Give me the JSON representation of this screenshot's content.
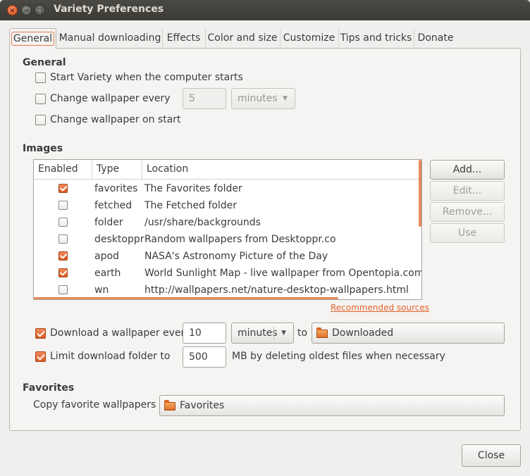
{
  "window": {
    "title": "Variety Preferences",
    "close_glyph": "×",
    "minimize_glyph": "−",
    "maximize_glyph": "□"
  },
  "tabs": [
    {
      "label": "General",
      "active": true
    },
    {
      "label": "Manual downloading"
    },
    {
      "label": "Effects"
    },
    {
      "label": "Color and size"
    },
    {
      "label": "Customize"
    },
    {
      "label": "Tips and tricks"
    },
    {
      "label": "Donate"
    }
  ],
  "general": {
    "heading": "General",
    "start_variety_label": "Start Variety when the computer starts",
    "start_variety_checked": false,
    "change_every_label": "Change wallpaper every",
    "change_every_checked": false,
    "change_every_value": "5",
    "change_every_unit": "minutes",
    "change_on_start_label": "Change wallpaper on start",
    "change_on_start_checked": false
  },
  "images": {
    "heading": "Images",
    "columns": [
      "Enabled",
      "Type",
      "Location"
    ],
    "rows": [
      {
        "enabled": true,
        "type": "favorites",
        "location": "The Favorites folder"
      },
      {
        "enabled": false,
        "type": "fetched",
        "location": "The Fetched folder"
      },
      {
        "enabled": false,
        "type": "folder",
        "location": "/usr/share/backgrounds"
      },
      {
        "enabled": false,
        "type": "desktoppr",
        "location": "Random wallpapers from Desktoppr.co"
      },
      {
        "enabled": true,
        "type": "apod",
        "location": "NASA's Astronomy Picture of the Day"
      },
      {
        "enabled": true,
        "type": "earth",
        "location": "World Sunlight Map - live wallpaper from Opentopia.com"
      },
      {
        "enabled": false,
        "type": "wn",
        "location": "http://wallpapers.net/nature-desktop-wallpapers.html"
      }
    ],
    "buttons": {
      "add": "Add...",
      "edit": "Edit...",
      "remove": "Remove...",
      "use": "Use"
    },
    "recommended_link": "Recommended sources"
  },
  "download": {
    "label": "Download a wallpaper every",
    "checked": true,
    "value": "10",
    "unit": "minutes",
    "to_label": "to",
    "folder": "Downloaded",
    "limit_label": "Limit download folder to",
    "limit_checked": true,
    "limit_value": "500",
    "limit_suffix": "MB by deleting oldest files when necessary"
  },
  "favorites": {
    "heading": "Favorites",
    "copy_label": "Copy favorite wallpapers to",
    "folder": "Favorites"
  },
  "footer": {
    "close": "Close"
  },
  "colors": {
    "accent": "#e07a4a",
    "titlebar": "#3c3b37"
  },
  "icons": [
    "window-close-icon",
    "window-minimize-icon",
    "window-maximize-icon",
    "dropdown-arrow-icon",
    "folder-icon",
    "checkbox-icon"
  ]
}
